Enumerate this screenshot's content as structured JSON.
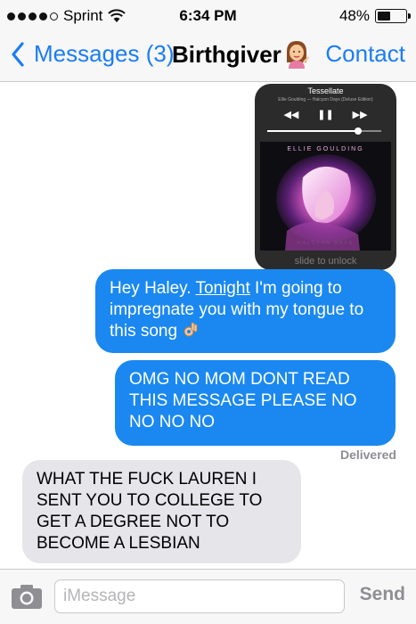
{
  "status_bar": {
    "carrier": "Sprint",
    "time": "6:34 PM",
    "battery_text": "48%",
    "battery_level": 0.48
  },
  "nav": {
    "back_label": "Messages (3)",
    "title": "Birthgiver",
    "title_emoji": "woman-tipping-hand-emoji",
    "contact_label": "Contact"
  },
  "attachment": {
    "song_title": "Tessellate",
    "song_subtitle": "Ellie Goulding — Halcyon Days (Deluxe Edition)",
    "artist": "ELLIE GOULDING",
    "album": "HALCYON DAYS",
    "slide_text": "slide to unlock",
    "volume_level": 0.8
  },
  "messages": [
    {
      "direction": "sent",
      "before": "Hey Haley. ",
      "link": "Tonight",
      "after": " I'm going to impregnate you with my tongue to this song",
      "emoji": "ok-hand-emoji"
    },
    {
      "direction": "sent",
      "text": "OMG NO MOM DONT READ THIS MESSAGE PLEASE NO NO NO NO"
    },
    {
      "direction": "received",
      "text": "WHAT THE FUCK LAUREN I SENT YOU TO COLLEGE TO GET A DEGREE NOT TO BECOME A LESBIAN"
    }
  ],
  "delivered_label": "Delivered",
  "composer": {
    "placeholder": "iMessage",
    "send_label": "Send"
  },
  "colors": {
    "accent": "#1a7cf5",
    "sent_bubble": "#1a88f0",
    "received_bubble": "#e5e5ea"
  }
}
